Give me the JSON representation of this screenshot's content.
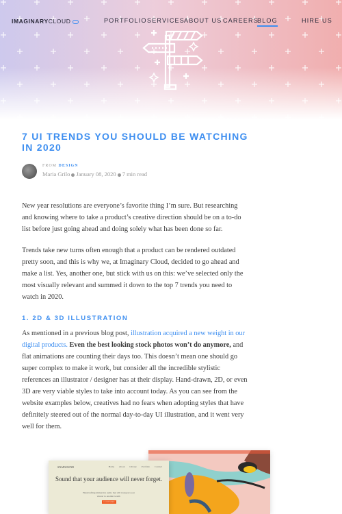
{
  "nav": {
    "logo_bold": "IMAGINARY",
    "logo_light": "CLOUD",
    "items": [
      {
        "label": "PORTFOLIO"
      },
      {
        "label": "SERVICES"
      },
      {
        "label": "ABOUT US"
      },
      {
        "label": "CAREERS"
      },
      {
        "label": "BLOG",
        "active": true
      }
    ],
    "cta": "HIRE US"
  },
  "article": {
    "title": "7 UI TRENDS YOU SHOULD BE WATCHING IN 2020",
    "from_label": "FROM",
    "category": "DESIGN",
    "author": "Maria Grilo",
    "date": "January 08, 2020",
    "read_time": "7 min read",
    "p1": "New year resolutions are everyone’s favorite thing I’m sure. But researching and knowing where to take a product’s creative direction should be on a to-do list before just going ahead and doing solely what has been done so far.",
    "p2": "Trends take new turns often enough that a product can be rendered outdated pretty soon, and this is why we, at Imaginary Cloud, decided to go ahead and make a list. Yes, another one, but stick with us on this: we’ve selected only the most visually relevant and summed it down to the top 7 trends you need to watch in 2020.",
    "h1": "1. 2D & 3D ILLUSTRATION",
    "p3_a": "As mentioned in a previous blog post, ",
    "p3_link": "illustration acquired a new weight in our digital products.",
    "p3_bold": " Even the best looking stock photos won’t do anymore,",
    "p3_b": " and flat animations are counting their days too. This doesn’t mean one should go super complex to make it work, but consider all the incredible stylistic references an illustrator / designer has at their display. Hand-drawn, 2D, or even 3D are very viable styles to take into account today. As you can see from the website examples below, creatives had no fears when adopting styles that have definitely steered out of the normal day-to-day UI illustration, and it went very well for them."
  },
  "example": {
    "logo": "SNAPSOUND",
    "nav": "Home About Library Portfolio Contact",
    "headline": "Sound that your audience will never forget.",
    "sub": "Handcrafting immersive audio that will transport your viewer to another world.",
    "button": "LEARN MORE"
  },
  "colors": {
    "accent": "#3d8ef0",
    "text": "#3a3a3a",
    "muted": "#999999"
  }
}
